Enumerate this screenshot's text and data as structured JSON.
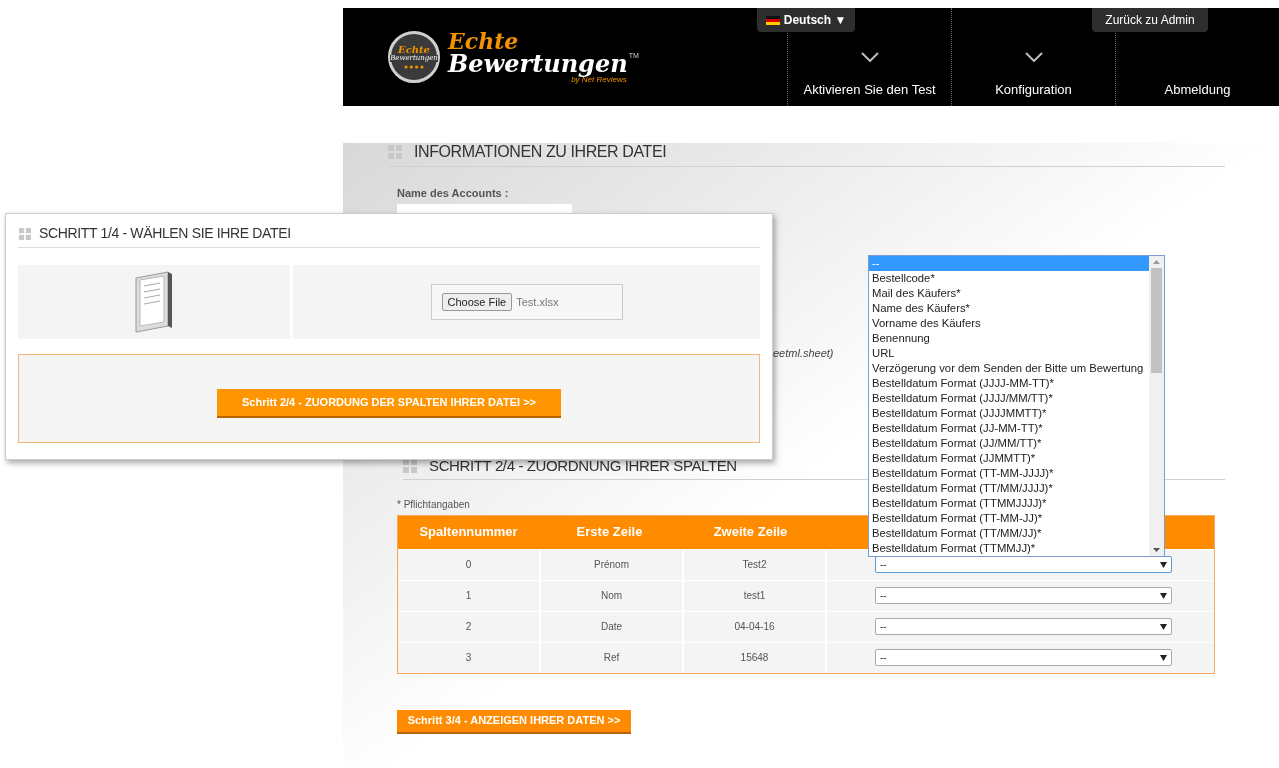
{
  "header": {
    "logo": {
      "badge_top": "Echte",
      "badge_middle": "Bewertungen",
      "word_top": "Echte",
      "word_main": "Bewertungen",
      "trademark": "TM",
      "byline": "by Net Reviews"
    },
    "language": {
      "label": "Deutsch",
      "caret": "▼"
    },
    "back_button": "Zurück zu Admin",
    "nav": [
      {
        "label": "Aktivieren Sie den Test",
        "kind": "menu"
      },
      {
        "label": "Konfiguration",
        "kind": "menu"
      },
      {
        "label": "Abmeldung",
        "kind": "link"
      }
    ]
  },
  "info_section": {
    "title": "INFORMATIONEN ZU IHRER DATEI",
    "account_label": "Name des Accounts :",
    "partial_text": "eetml.sheet)"
  },
  "mapping_section": {
    "title": "SCHRITT 2/4 - ZUORDNUNG IHRER SPALTEN",
    "required_note": "* Pflichtangaben",
    "columns": [
      "Spaltennummer",
      "Erste Zeile",
      "Zweite Zeile"
    ],
    "rows": [
      {
        "cells": [
          "0",
          "Prénom",
          "Test2"
        ],
        "mapping": "--",
        "focused": true
      },
      {
        "cells": [
          "1",
          "Nom",
          "test1"
        ],
        "mapping": "--",
        "focused": false
      },
      {
        "cells": [
          "2",
          "Date",
          "04-04-16"
        ],
        "mapping": "--",
        "focused": false
      },
      {
        "cells": [
          "3",
          "Ref",
          "15648"
        ],
        "mapping": "--",
        "focused": false
      }
    ],
    "next_button": "Schritt 3/4 - ANZEIGEN IHRER DATEN >>"
  },
  "dropdown": {
    "options": [
      {
        "label": "--",
        "selected": true
      },
      {
        "label": "Bestellcode*",
        "selected": false
      },
      {
        "label": "Mail des Käufers*",
        "selected": false
      },
      {
        "label": "Name des Käufers*",
        "selected": false
      },
      {
        "label": "Vorname des Käufers",
        "selected": false
      },
      {
        "label": "Benennung",
        "selected": false
      },
      {
        "label": "URL",
        "selected": false
      },
      {
        "label": "Verzögerung vor dem Senden der Bitte um Bewertung",
        "selected": false
      },
      {
        "label": "Bestelldatum Format (JJJJ-MM-TT)*",
        "selected": false
      },
      {
        "label": "Bestelldatum Format (JJJJ/MM/TT)*",
        "selected": false
      },
      {
        "label": "Bestelldatum Format (JJJJMMTT)*",
        "selected": false
      },
      {
        "label": "Bestelldatum Format (JJ-MM-TT)*",
        "selected": false
      },
      {
        "label": "Bestelldatum Format (JJ/MM/TT)*",
        "selected": false
      },
      {
        "label": "Bestelldatum Format (JJMMTT)*",
        "selected": false
      },
      {
        "label": "Bestelldatum Format (TT-MM-JJJJ)*",
        "selected": false
      },
      {
        "label": "Bestelldatum Format (TT/MM/JJJJ)*",
        "selected": false
      },
      {
        "label": "Bestelldatum Format (TTMMJJJJ)*",
        "selected": false
      },
      {
        "label": "Bestelldatum Format (TT-MM-JJ)*",
        "selected": false
      },
      {
        "label": "Bestelldatum Format (TT/MM/JJ)*",
        "selected": false
      },
      {
        "label": "Bestelldatum Format (TTMMJJ)*",
        "selected": false
      }
    ]
  },
  "popup": {
    "title": "SCHRITT 1/4 - WÄHLEN SIE IHRE DATEI",
    "file_button": "Choose File",
    "file_name": "Test.xlsx",
    "next_button": "Schritt 2/4 - ZUORDUNG DER SPALTEN IHRER DATEI >>"
  }
}
